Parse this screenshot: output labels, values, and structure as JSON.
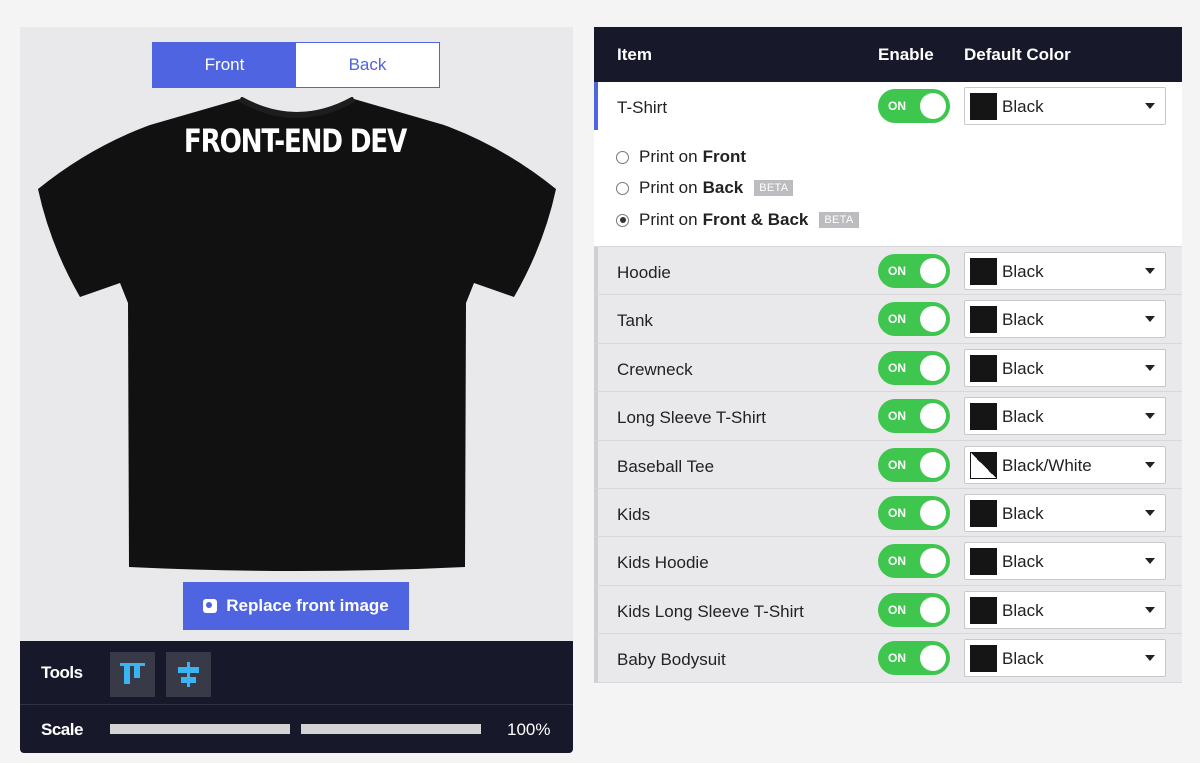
{
  "preview": {
    "view_tabs": [
      {
        "label": "Front",
        "active": true
      },
      {
        "label": "Back",
        "active": false
      }
    ],
    "shirt_color": "#111111",
    "design_text": "FRONT-END DEV",
    "replace_button": "Replace front image",
    "accent": "#4e64e0"
  },
  "tools": {
    "label": "Tools",
    "buttons": [
      "align-top-icon",
      "align-center-icon"
    ],
    "scale_label": "Scale",
    "scale_value": "100%"
  },
  "table": {
    "headers": {
      "item": "Item",
      "enable": "Enable",
      "color": "Default Color"
    },
    "toggle_label": "ON",
    "print_options": [
      {
        "prefix": "Print on",
        "bold": "Front",
        "beta": false,
        "checked": false
      },
      {
        "prefix": "Print on",
        "bold": "Back",
        "beta": true,
        "checked": false
      },
      {
        "prefix": "Print on",
        "bold": "Front & Back",
        "beta": true,
        "checked": true
      }
    ],
    "beta_label": "BETA",
    "rows": [
      {
        "item": "T-Shirt",
        "color": "Black"
      },
      {
        "item": "Hoodie",
        "color": "Black"
      },
      {
        "item": "Tank",
        "color": "Black"
      },
      {
        "item": "Crewneck",
        "color": "Black"
      },
      {
        "item": "Long Sleeve T-Shirt",
        "color": "Black"
      },
      {
        "item": "Baseball Tee",
        "color": "Black/White"
      },
      {
        "item": "Kids",
        "color": "Black"
      },
      {
        "item": "Kids Hoodie",
        "color": "Black"
      },
      {
        "item": "Kids Long Sleeve T-Shirt",
        "color": "Black"
      },
      {
        "item": "Baby Bodysuit",
        "color": "Black"
      }
    ]
  }
}
